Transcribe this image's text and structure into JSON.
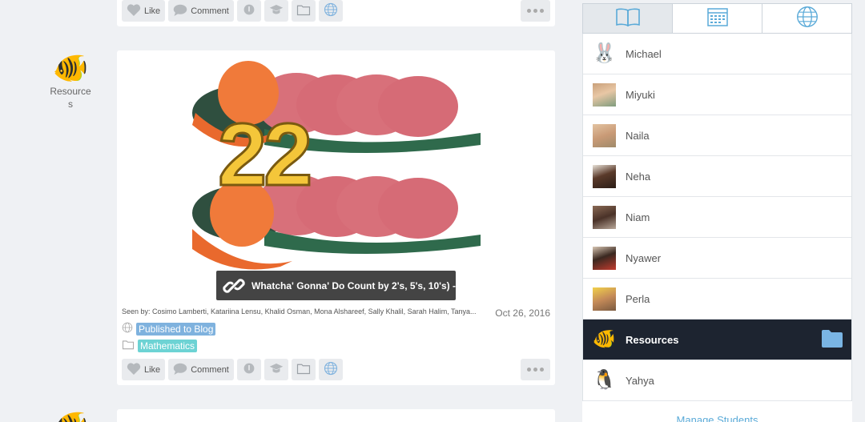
{
  "top_card": {
    "actions": {
      "like": "Like",
      "comment": "Comment"
    }
  },
  "post": {
    "author": "Resources",
    "image_number": "22",
    "link_title": "Whatcha' Gonna' Do Count by 2's, 5's, 10's) -",
    "seen_by": "Seen by: Cosimo Lamberti, Katariina Lensu, Khalid Osman, Mona Alshareef, Sally Khalil, Sarah Halim, Tanya...",
    "date": "Oct 26, 2016",
    "tags": [
      {
        "label": "Published to Blog",
        "color": "#7fb2de",
        "icon": "globe-icon"
      },
      {
        "label": "Mathematics",
        "color": "#6dd3d4",
        "icon": "folder-icon"
      }
    ],
    "actions": {
      "like": "Like",
      "comment": "Comment"
    }
  },
  "sidebar": {
    "tabs": [
      {
        "name": "journal",
        "icon": "book-icon",
        "active": true
      },
      {
        "name": "calendar",
        "icon": "calendar-icon",
        "active": false
      },
      {
        "name": "blog",
        "icon": "globe-icon",
        "active": false
      }
    ],
    "students": [
      {
        "name": "Michael",
        "avatar": "🐰"
      },
      {
        "name": "Miyuki",
        "avatar": "photo"
      },
      {
        "name": "Naila",
        "avatar": "photo"
      },
      {
        "name": "Neha",
        "avatar": "photo"
      },
      {
        "name": "Niam",
        "avatar": "photo"
      },
      {
        "name": "Nyawer",
        "avatar": "photo"
      },
      {
        "name": "Perla",
        "avatar": "photo"
      },
      {
        "name": "Resources",
        "avatar": "🐠",
        "selected": true
      },
      {
        "name": "Yahya",
        "avatar": "🐧"
      }
    ],
    "manage_label": "Manage Students"
  },
  "colors": {
    "accent": "#5aaad8",
    "selected_bg": "#1d2430",
    "folder": "#7ab5e4"
  }
}
